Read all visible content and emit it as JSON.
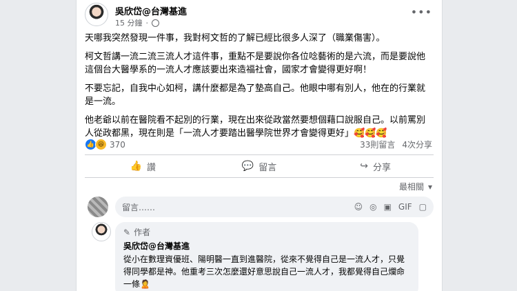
{
  "post": {
    "author": "吳欣岱@台灣基進",
    "time": "15 分鐘",
    "more_icon": "•••",
    "paragraphs": [
      "天哪我突然發現一件事，我對柯文哲的了解已經比很多人深了（職業傷害）。",
      "柯文哲講一流二流三流人才這件事，重點不是要說你各位唸藝術的是六流，而是要說他這個台大醫學系的一流人才應該要出來造福社會，國家才會變得更好啊！",
      "不要忘記，自我中心如柯，講什麼都是為了墊高自己。他眼中哪有別人，他在的行業就是一流。",
      "他老爺以前在醫院看不起別的行業，現在出來從政當然要想個藉口說服自己。以前罵別人從政都黑，現在則是「一流人才要踏出醫學院世界才會變得更好」🥰🥰🥰"
    ],
    "reaction_count": "370",
    "comments_count": "33則留言",
    "shares_count": "4次分享"
  },
  "actions": {
    "like": "讚",
    "comment": "留言",
    "share": "分享"
  },
  "sort": {
    "label": "最相關",
    "chevron": "▾"
  },
  "composer": {
    "placeholder": "留言……",
    "icons": [
      "☺",
      "◎",
      "▣",
      "GIF",
      "▢"
    ]
  },
  "comment": {
    "badge": "作者",
    "author": "吳欣岱@台灣基進",
    "text": "從小在數理資優班、陽明醫一直到進醫院，從來不覺得自己是一流人才，只覺得同學都是神。他重考三次怎麼還好意思說自己一流人才，我都覺得自己爛命一條🙎"
  }
}
